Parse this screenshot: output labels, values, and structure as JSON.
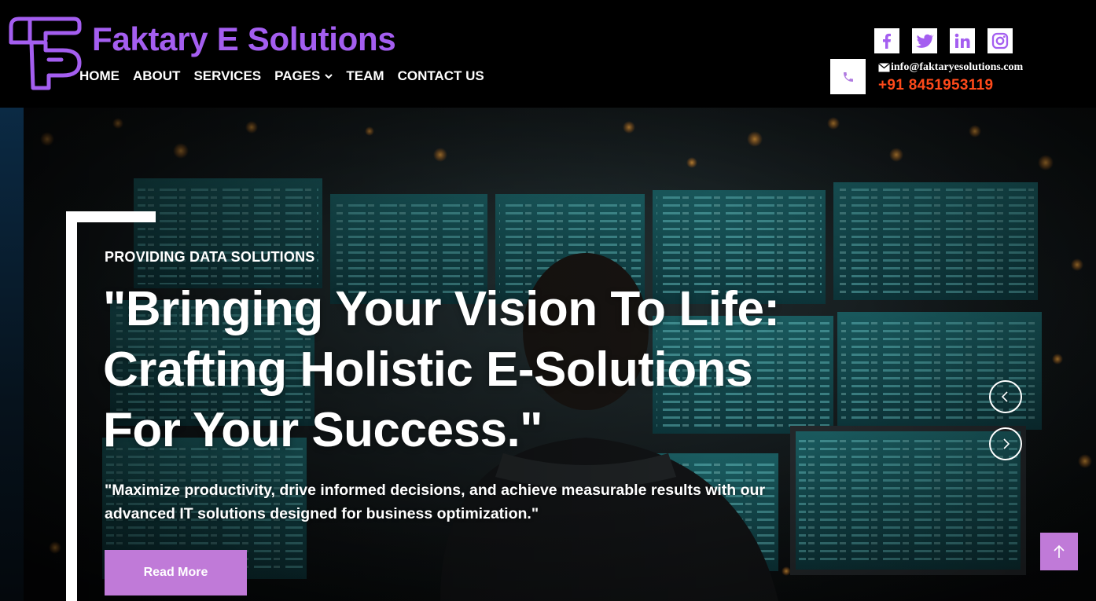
{
  "brand": {
    "name": "Faktary E Solutions",
    "logo_icon": "faktary-logo-icon",
    "color": "#a45ef0"
  },
  "nav": {
    "items": [
      {
        "label": "HOME"
      },
      {
        "label": "ABOUT"
      },
      {
        "label": "SERVICES"
      },
      {
        "label": "PAGES",
        "dropdown_icon": "chevron-down-icon"
      },
      {
        "label": "TEAM"
      },
      {
        "label": "CONTACT US"
      }
    ]
  },
  "socials": [
    {
      "icon": "facebook-icon"
    },
    {
      "icon": "twitter-icon"
    },
    {
      "icon": "linkedin-icon"
    },
    {
      "icon": "instagram-icon"
    }
  ],
  "contact": {
    "email": "info@faktaryesolutions.com",
    "phone": "+91 8451953119",
    "phone_icon": "phone-icon",
    "email_icon": "envelope-icon",
    "phone_color": "#ff4a1a"
  },
  "hero": {
    "kicker": "PROVIDING DATA SOLUTIONS",
    "headline": "\"Bringing Your Vision To Life: Crafting Holistic E-Solutions For Your Success.\"",
    "subtext": "\"Maximize productivity, drive informed decisions, and achieve measurable results with our advanced IT solutions designed for business optimization.\"",
    "cta_label": "Read More",
    "accent": "#c07ad8",
    "prev_icon": "chevron-left-icon",
    "next_icon": "chevron-right-icon",
    "scroll_top_icon": "arrow-up-icon"
  }
}
